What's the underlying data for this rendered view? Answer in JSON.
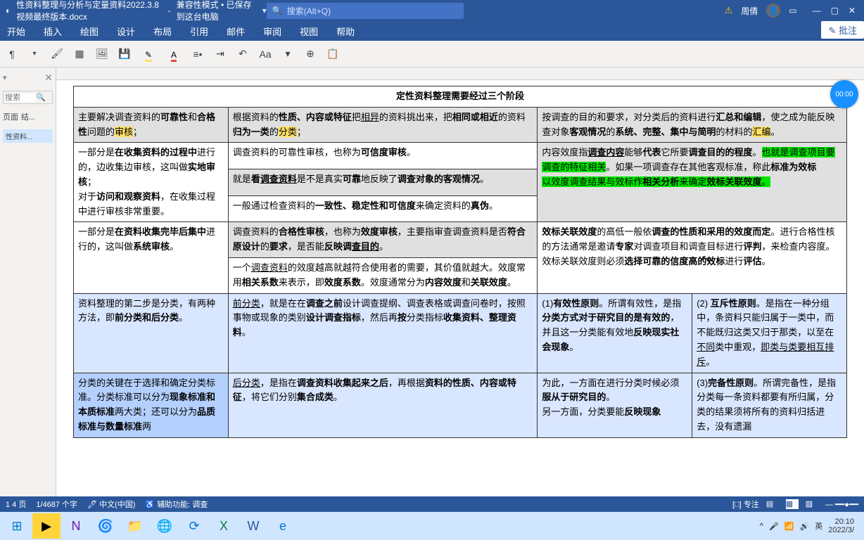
{
  "title": {
    "doc_name": "性资料整理与分析与定量资料2022.3.8视频最终版本.docx",
    "mode": "兼容性模式 • 已保存到这台电脑",
    "search_placeholder": "搜索(Alt+Q)",
    "user_name": "周倩"
  },
  "ribbon_tabs": [
    "开始",
    "插入",
    "绘图",
    "设计",
    "布局",
    "引用",
    "邮件",
    "审阅",
    "视图",
    "帮助"
  ],
  "ribbon_right": "批注",
  "sidepane": {
    "search_placeholder": "搜索",
    "tab1": "页面",
    "tab2": "结...",
    "doctab": "性资料..."
  },
  "timer": "00:00",
  "table": {
    "header": "定性资料整理需要经过三个阶段",
    "r1c1a": "主要解决调查资料的",
    "r1c1b": "可靠性",
    "r1c1c": "和",
    "r1c1d": "合格性",
    "r1c1e": "问题的",
    "r1c1f": "审核",
    "r1c1g": "；",
    "r1c2": "根据资料的<b>性质、内容或特征</b>把<u>相异</u>的资料挑出来，把<b>相同或相近</b>的资料<b>归为一类</b>的<span class='h-yellow'>分类</span>；",
    "r1c3": "按调查的目的和要求，对分类后的资料进行<b>汇总和编辑</b>，使之成为能反映<br>查对象<b>客观情况</b>的<b>系统、完整、集中与简明</b>的材料的<span class='h-yellow'>汇编</span>。",
    "r2c2": "调查资料的可靠性审核，也称为<b>可信度审核</b>。",
    "r3c1": "一部分是<b>在收集资料的过程中</b>进行的，边收集边审核，这叫做<b>实地审核</b>；<br>对于<b>访问和观察资料</b>，在收集过程中进行审核非常重要。",
    "r3c2": "就是<b>看<u>调查资料</u></b>是不是真实<b>可靠</b>地反映了<b>调查对象的客观情况</b>。",
    "r3c3": "内容效度指<b><u>调查内容</u></b>能够<b>代表</b>它所要<b>调查目的的程度</b>。<span class='h-green'>也就是调查项目要调查的特征相关</span>。如果一项调查存在其他客观标准，称此<b>标准为效标</b><br><span class='h-green'>以效度调查结果与效标作<b>相关分析</b>来确定<b>效标关联效度</b>。</span>",
    "r4c2": "一般通过检查资料的<b>一致性、稳定性和可信度</b>来确定资料的<b>真伪</b>。",
    "r5c2": "调查资料的<b>合格性审核</b>，也称为<b>效度审核</b>，主要指审查调查资料是否<b>符合原设计</b>的<b>要求</b>，是否能<b>反映调<u>查目的</u></b>。",
    "r6c1": "一部分是<b>在资料收集完毕后集中</b>进行的，这叫做<b>系统审核</b>。",
    "r6c2": "一个<u>调查资料</u>的效度越高就越符合使用者的需要，其价值就越大。效度常用<b>相关系数</b>来表示，即<b>效度系数</b>。效度通常分为<b>内容效度</b>和<b>关联效度</b>。",
    "r6c3": "<b>效标关联效度</b>的高低一般依<b>调查的性质和采用的效度而定</b>。进行合格性核的方法通常是邀请<b>专家</b>对调查项目和调查目标进行<b>评判</b>，来检查内容度。效标关联效度则必须<b>选择可靠的信度高的效标</b>进行<b>评估</b>。",
    "r7c1": "资料整理的第二步是分类，有两种方法，即<b>前分类和后分类</b>。",
    "r7c2": "<u>前分类</u>，就是在在<b>调查之前</b>设计调查提纲、调查表格或调查问卷时，按照事物或现象的类别<b>设计调查指标</b>，然后再<b>按</b>分类指标<b>收集资料、整理资料</b>。",
    "r7c3": "(1)<b>有效性原则</b>。所谓有效性，是指<b>分类方式对于研究目的是有效的</b>，并且这一分类能有效地<b>反映现实社会现象</b>。",
    "r7c4": "(2) <b>互斥性原则</b>。是指在一种分组中，条资料只能归属于一类中，而不能既归这类又归于那类，以至在<u>不同</u>类中重观，<u>即类与类要相互排斥</u>。",
    "r8c1": "分类的关键在于选择和确定分类标准。分类标准可以分为<b>现象标准和本质标准</b>两大类；还可以分为<b>品质标准与数量标准</b>两",
    "r8c2": "<u>后分类</u>，是指在<b>调查资料收集起来之后</b>，再根据<b>资料的性质、内容或特征</b>，将它们分别<b>集合成类</b>。",
    "r8c3": "为此，一方面在进行分类时候必须<b>服从于研究目的</b>。<br>另一方面，分类要能<b>反映现象</b>",
    "r8c4": "(3)<b>完备性原则</b>。所谓完备性，是指分类每一条资料都要有所归属，分类的结果须将所有的资料归括进去，没有遗漏"
  },
  "status": {
    "page": "1 4 页",
    "words": "1/4687 个字",
    "lang": "中文(中国)",
    "a11y": "辅助功能: 调查",
    "focus": "专注"
  },
  "systray": {
    "time": "20:10",
    "date": "2022/3/",
    "ime": "英"
  }
}
